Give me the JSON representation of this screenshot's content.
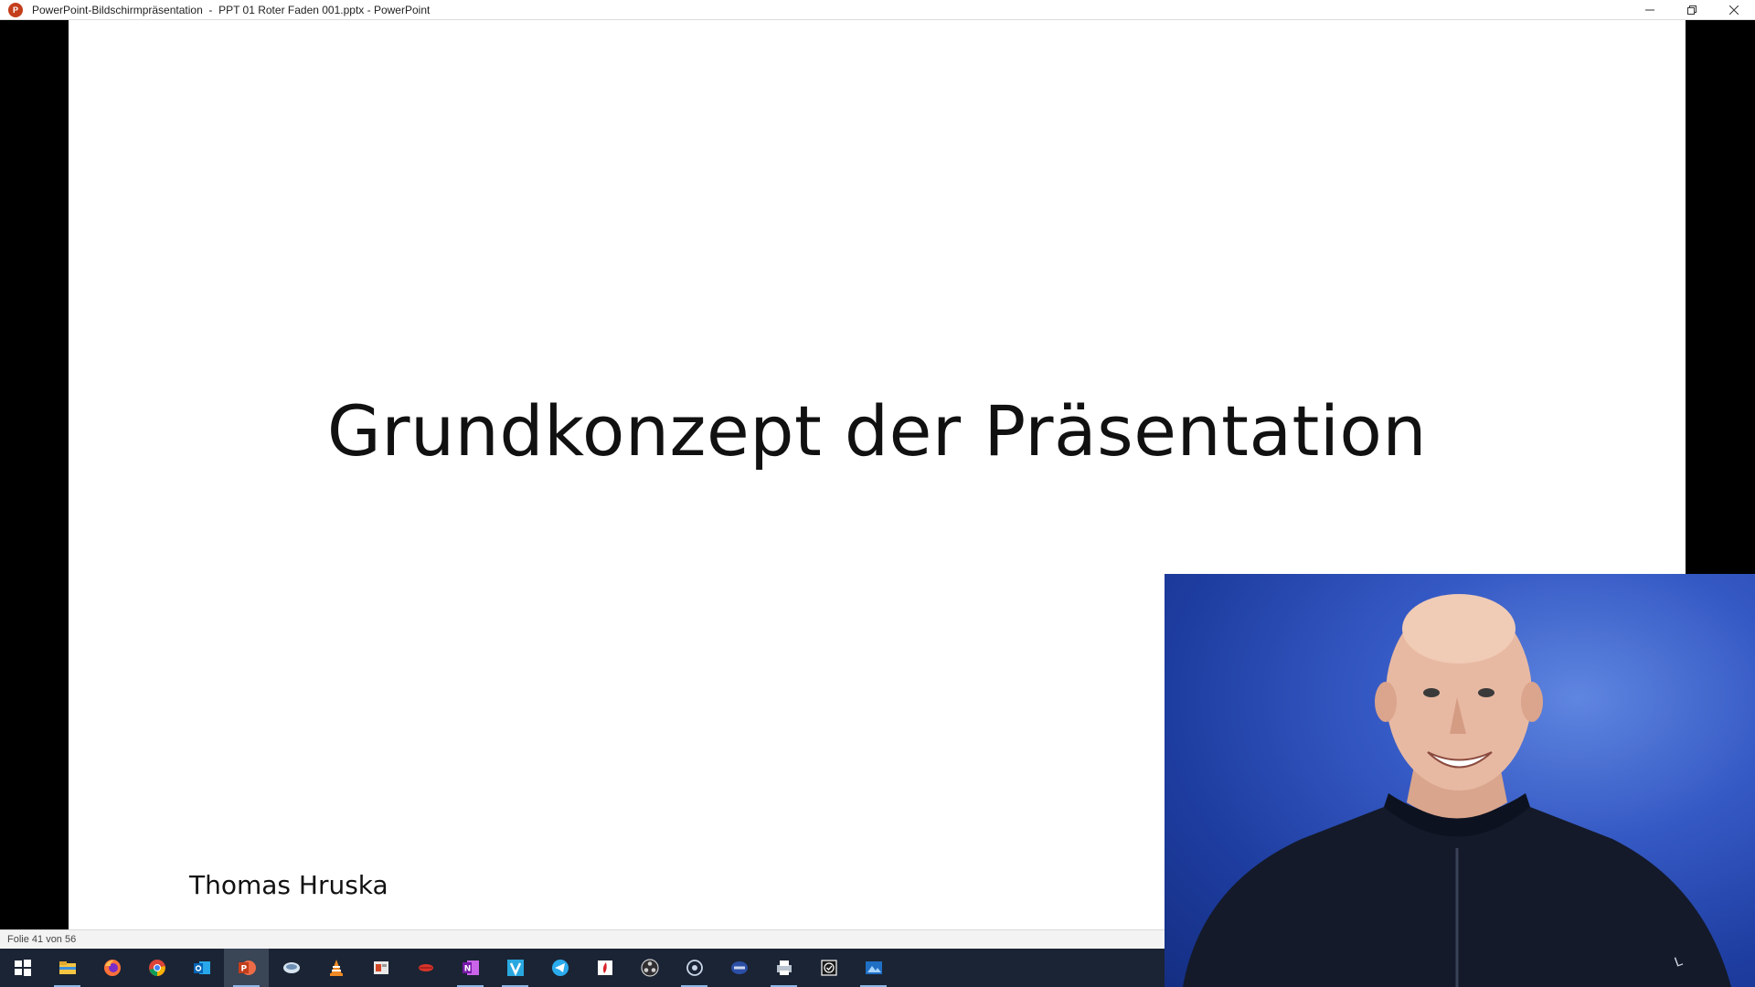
{
  "window": {
    "title": "PowerPoint-Bildschirmpräsentation  -  PPT 01 Roter Faden 001.pptx - PowerPoint",
    "app_icon": "powerpoint-icon",
    "app_icon_letter": "P"
  },
  "slide": {
    "title": "Grundkonzept der Präsentation",
    "author": "Thomas Hruska"
  },
  "status": {
    "slide_counter": "Folie 41 von 56"
  },
  "taskbar": {
    "items": [
      {
        "name": "windows-start-icon",
        "active": false
      },
      {
        "name": "file-explorer-icon",
        "active": false
      },
      {
        "name": "firefox-icon",
        "active": false
      },
      {
        "name": "chrome-icon",
        "active": false
      },
      {
        "name": "outlook-icon",
        "active": false
      },
      {
        "name": "powerpoint-icon",
        "active": true
      },
      {
        "name": "snagit-icon",
        "active": false
      },
      {
        "name": "vlc-icon",
        "active": false
      },
      {
        "name": "screenshot-tool-icon",
        "active": false
      },
      {
        "name": "lips-app-icon",
        "active": false
      },
      {
        "name": "onenote-icon",
        "active": false
      },
      {
        "name": "vectorworks-icon",
        "active": false
      },
      {
        "name": "telegram-icon",
        "active": false
      },
      {
        "name": "red-app-icon",
        "active": false
      },
      {
        "name": "obs-studio-icon",
        "active": false
      },
      {
        "name": "circle-app-icon",
        "active": false
      },
      {
        "name": "blue-app-icon",
        "active": false
      },
      {
        "name": "printer-icon",
        "active": false
      },
      {
        "name": "checklist-app-icon",
        "active": false
      },
      {
        "name": "photos-icon",
        "active": false
      }
    ]
  },
  "colors": {
    "powerpoint": "#c43e1c",
    "taskbar_bg": "#1b2434",
    "webcam_bg": "#2a4bbd"
  }
}
